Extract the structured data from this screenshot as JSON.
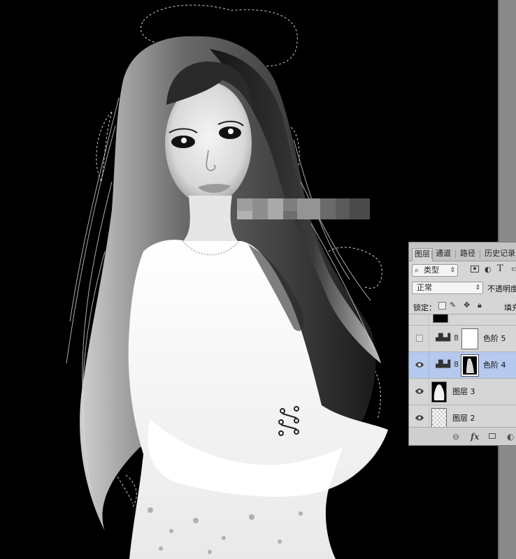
{
  "panel": {
    "tabs": [
      {
        "label": "图层",
        "active": true
      },
      {
        "label": "通道",
        "active": false
      },
      {
        "label": "路径",
        "active": false
      },
      {
        "label": "历史记录",
        "active": false
      }
    ],
    "filter": {
      "label": "类型"
    },
    "blend_mode": "正常",
    "opacity_label": "不透明度",
    "lock_label": "锁定：",
    "fill_label": "填充",
    "layers": [
      {
        "name": "",
        "visible": true,
        "kind": "partial"
      },
      {
        "name": "色阶 5",
        "visible": false,
        "kind": "levels-adjustment",
        "mask": "white"
      },
      {
        "name": "色阶 4",
        "visible": true,
        "kind": "levels-adjustment",
        "mask": "silhouette",
        "selected": true
      },
      {
        "name": "图层 3",
        "visible": true,
        "kind": "pixel",
        "thumb": "white-figure-on-black"
      },
      {
        "name": "图层 2",
        "visible": true,
        "kind": "pixel",
        "thumb": "transparent"
      }
    ],
    "footer_icons": [
      "link-icon",
      "fx-icon",
      "mask-icon",
      "adjustment-icon"
    ]
  },
  "colors": {
    "canvas_bg": "#000000",
    "panel_bg": "#d6d6d6",
    "selected_row": "#b5c8ee",
    "gutter": "#8a8a8a"
  }
}
